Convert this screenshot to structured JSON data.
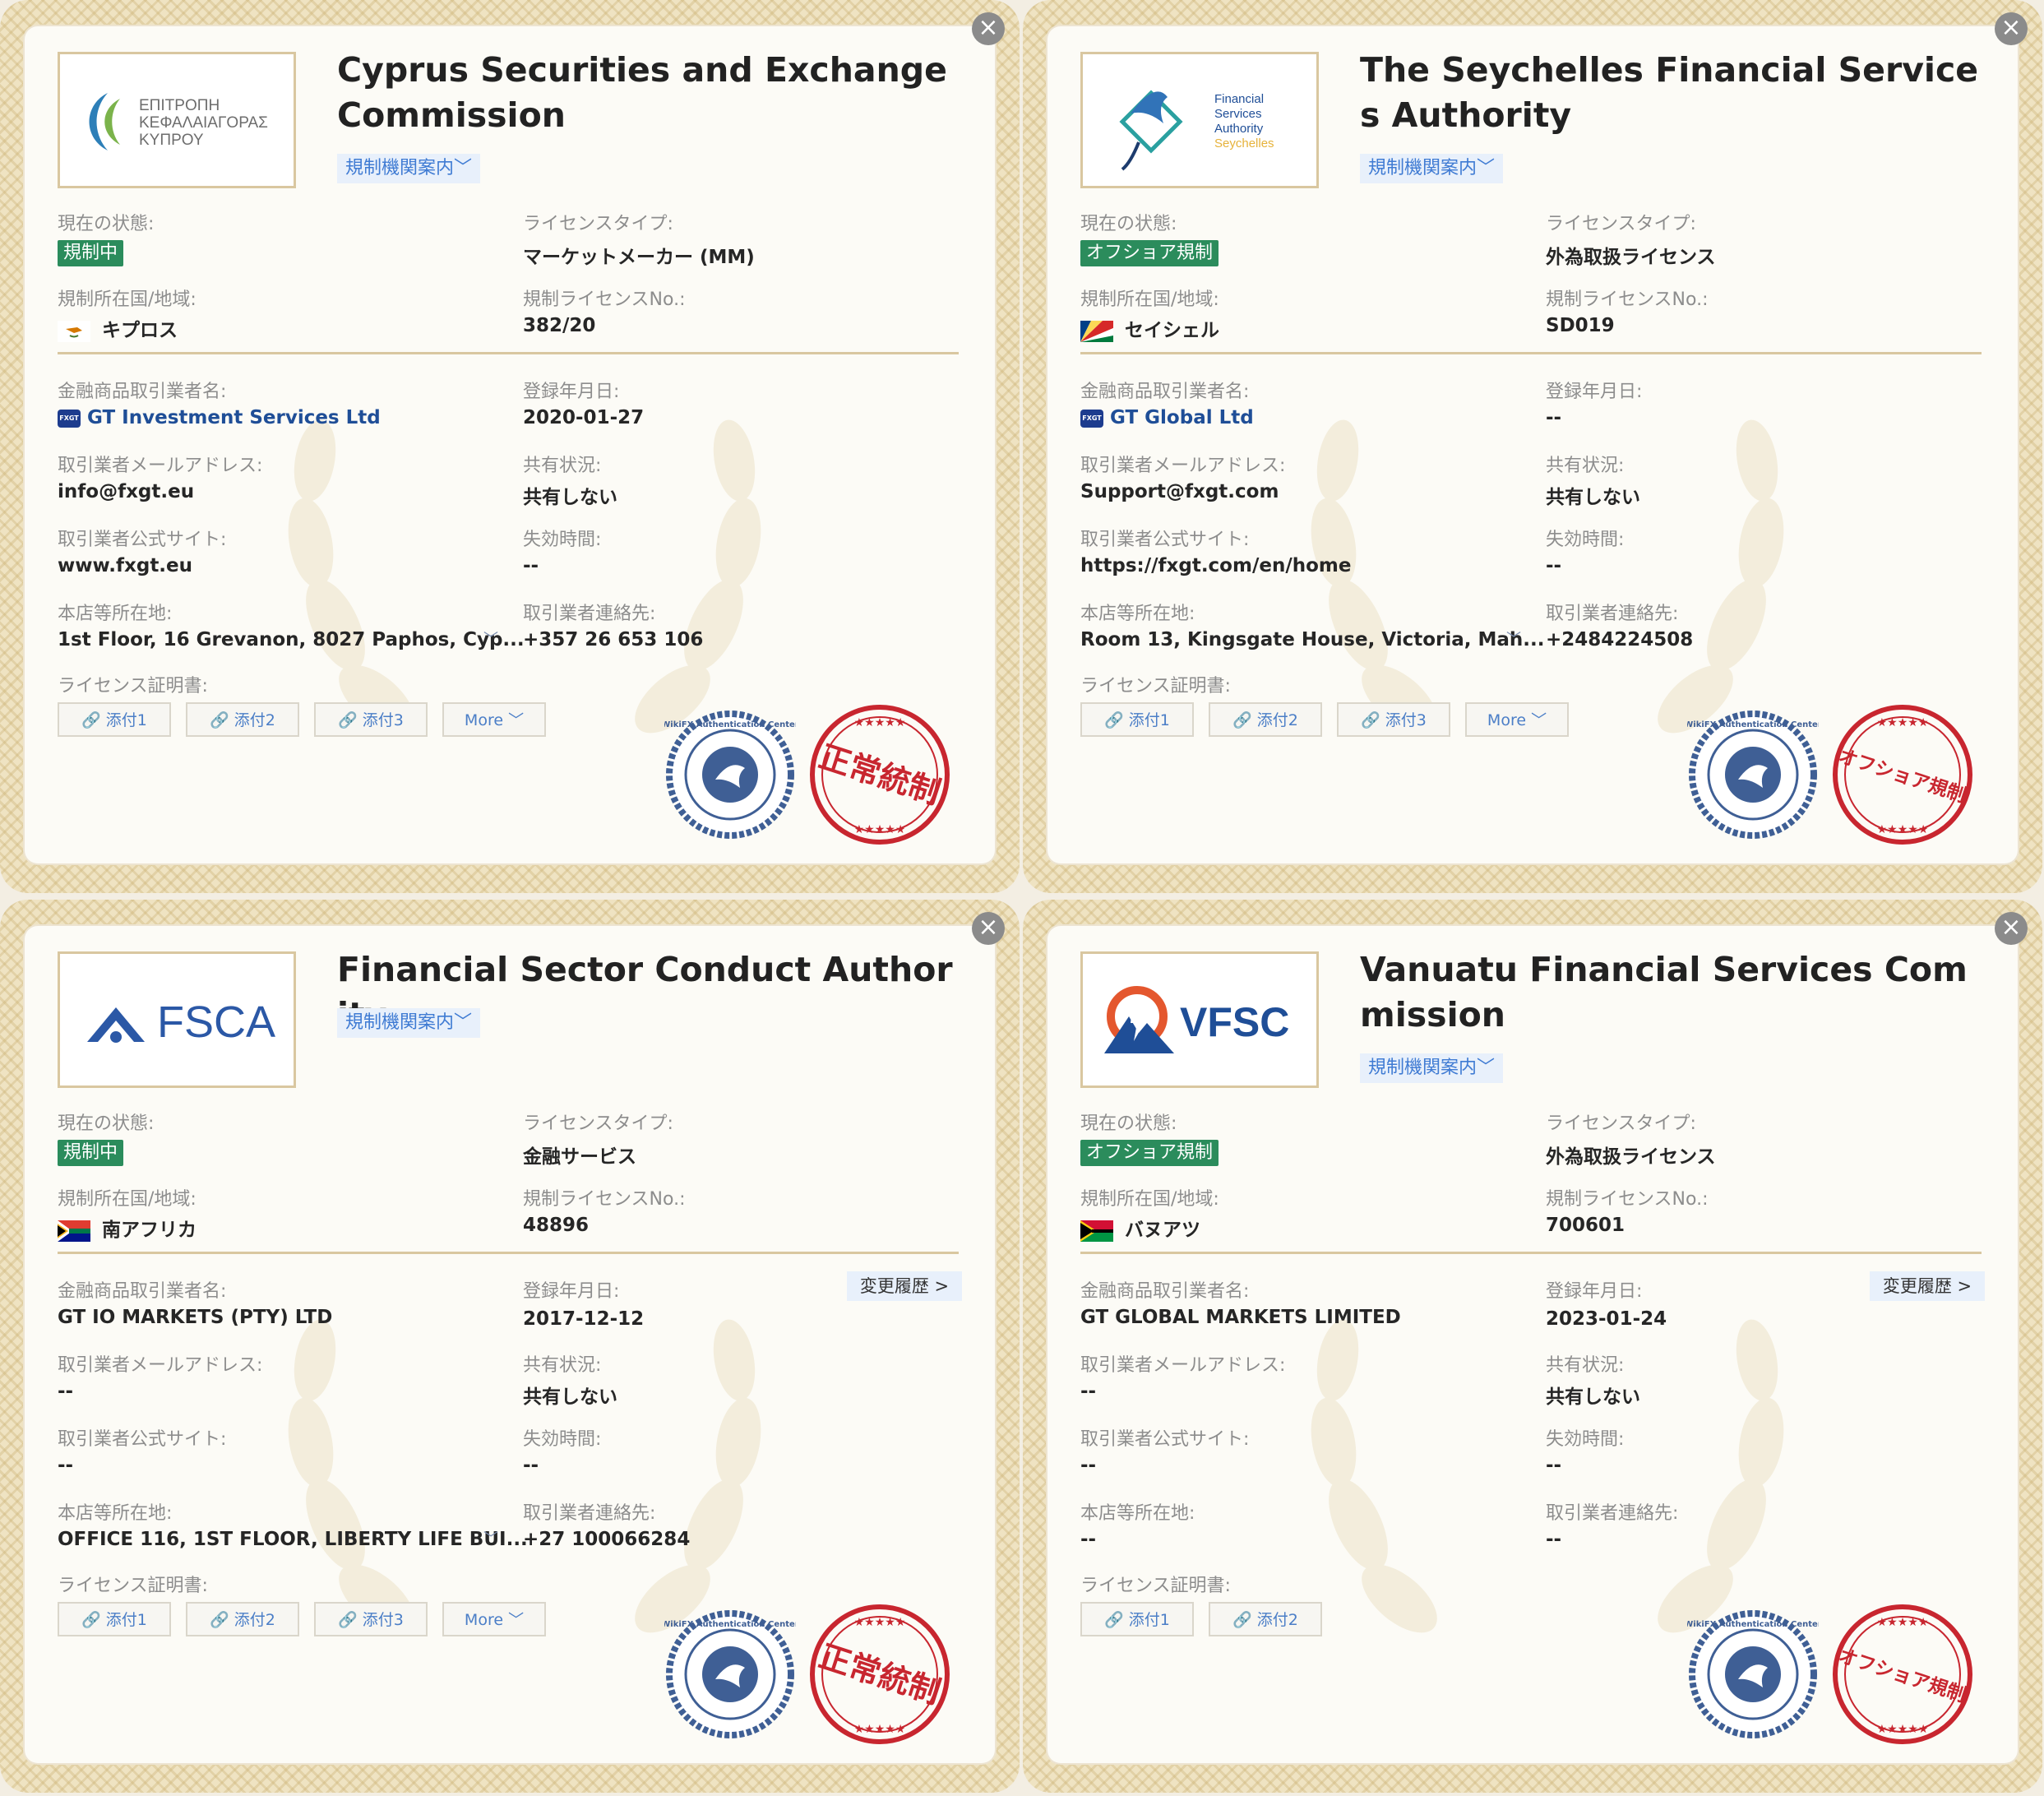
{
  "close_symbol": "×",
  "cards": [
    {
      "title": "Cyprus Securities and Exchange Commission",
      "guide": "規制機関案内﹀",
      "logo_text": [
        "ΕΠΙΤΡΟΠΗ",
        "ΚΕΦΑΛΑΙΑΓΟΡΑΣ",
        "ΚΥΠΡΟΥ"
      ],
      "status_label": "現在の状態:",
      "status": "規制中",
      "license_type_label": "ライセンスタイプ:",
      "license_type": "マーケットメーカー (MM)",
      "region_label": "規制所在国/地域:",
      "region": "キプロス",
      "license_no_label": "規制ライセンスNo.:",
      "license_no": "382/20",
      "broker_label": "金融商品取引業者名:",
      "broker": "GT Investment Services Ltd",
      "reg_date_label": "登録年月日:",
      "reg_date": "2020-01-27",
      "email_label": "取引業者メールアドレス:",
      "email": "info@fxgt.eu",
      "share_label": "共有状況:",
      "share": "共有しない",
      "site_label": "取引業者公式サイト:",
      "site": "www.fxgt.eu",
      "expiry_label": "失効時間:",
      "expiry": "--",
      "address_label": "本店等所在地:",
      "address": "1st Floor, 16 Grevanon, 8027 Paphos, Cyp...",
      "contact_label": "取引業者連絡先:",
      "contact": "+357 26 653 106",
      "cert_label": "ライセンス証明書:",
      "attachments": [
        "添付1",
        "添付2",
        "添付3"
      ],
      "more": "More",
      "stamp": "正常統制",
      "seal_text": "WikiFX Authentication Center"
    },
    {
      "title": "The Seychelles Financial Services Authority",
      "guide": "規制機関案内﹀",
      "logo_text": [
        "Financial",
        "Services",
        "Authority",
        "Seychelles"
      ],
      "status_label": "現在の状態:",
      "status": "オフショア規制",
      "license_type_label": "ライセンスタイプ:",
      "license_type": "外為取扱ライセンス",
      "region_label": "規制所在国/地域:",
      "region": "セイシェル",
      "license_no_label": "規制ライセンスNo.:",
      "license_no": "SD019",
      "broker_label": "金融商品取引業者名:",
      "broker": "GT Global Ltd",
      "reg_date_label": "登録年月日:",
      "reg_date": "--",
      "email_label": "取引業者メールアドレス:",
      "email": "Support@fxgt.com",
      "share_label": "共有状況:",
      "share": "共有しない",
      "site_label": "取引業者公式サイト:",
      "site": "https://fxgt.com/en/home",
      "expiry_label": "失効時間:",
      "expiry": "--",
      "address_label": "本店等所在地:",
      "address": "Room 13, Kingsgate House, Victoria, Mah...",
      "contact_label": "取引業者連絡先:",
      "contact": "+2484224508",
      "cert_label": "ライセンス証明書:",
      "attachments": [
        "添付1",
        "添付2",
        "添付3"
      ],
      "more": "More",
      "stamp": "オフショア規制",
      "seal_text": "WikiFX Authentication Center"
    },
    {
      "title": "Financial Sector Conduct Authority",
      "guide": "規制機関案内﹀",
      "logo_text": [
        "FSCA"
      ],
      "status_label": "現在の状態:",
      "status": "規制中",
      "license_type_label": "ライセンスタイプ:",
      "license_type": "金融サービス",
      "region_label": "規制所在国/地域:",
      "region": "南アフリカ",
      "license_no_label": "規制ライセンスNo.:",
      "license_no": "48896",
      "broker_label": "金融商品取引業者名:",
      "broker": "GT IO MARKETS (PTY) LTD",
      "reg_date_label": "登録年月日:",
      "reg_date": "2017-12-12",
      "history": "変更履歴 >",
      "email_label": "取引業者メールアドレス:",
      "email": "--",
      "share_label": "共有状況:",
      "share": "共有しない",
      "site_label": "取引業者公式サイト:",
      "site": "--",
      "expiry_label": "失効時間:",
      "expiry": "--",
      "address_label": "本店等所在地:",
      "address": "OFFICE 116, 1ST FLOOR, LIBERTY LIFE BUI...",
      "contact_label": "取引業者連絡先:",
      "contact": "+27 100066284",
      "cert_label": "ライセンス証明書:",
      "attachments": [
        "添付1",
        "添付2",
        "添付3"
      ],
      "more": "More",
      "stamp": "正常統制",
      "seal_text": "WikiFX Authentication Center"
    },
    {
      "title": "Vanuatu Financial Services Commission",
      "guide": "規制機関案内﹀",
      "logo_text": [
        "VFSC"
      ],
      "status_label": "現在の状態:",
      "status": "オフショア規制",
      "license_type_label": "ライセンスタイプ:",
      "license_type": "外為取扱ライセンス",
      "region_label": "規制所在国/地域:",
      "region": "バヌアツ",
      "license_no_label": "規制ライセンスNo.:",
      "license_no": "700601",
      "broker_label": "金融商品取引業者名:",
      "broker": "GT GLOBAL MARKETS LIMITED",
      "reg_date_label": "登録年月日:",
      "reg_date": "2023-01-24",
      "history": "変更履歴 >",
      "email_label": "取引業者メールアドレス:",
      "email": "--",
      "share_label": "共有状況:",
      "share": "共有しない",
      "site_label": "取引業者公式サイト:",
      "site": "--",
      "expiry_label": "失効時間:",
      "expiry": "--",
      "address_label": "本店等所在地:",
      "address": "--",
      "contact_label": "取引業者連絡先:",
      "contact": "--",
      "cert_label": "ライセンス証明書:",
      "attachments": [
        "添付1",
        "添付2"
      ],
      "stamp": "オフショア規制",
      "seal_text": "WikiFX Authentication Center"
    }
  ],
  "colors": {
    "status_green": "#2b8c5c",
    "link_blue": "#1f4e97",
    "stamp_red": "#c8262f",
    "seal_blue": "#3f5f95"
  }
}
